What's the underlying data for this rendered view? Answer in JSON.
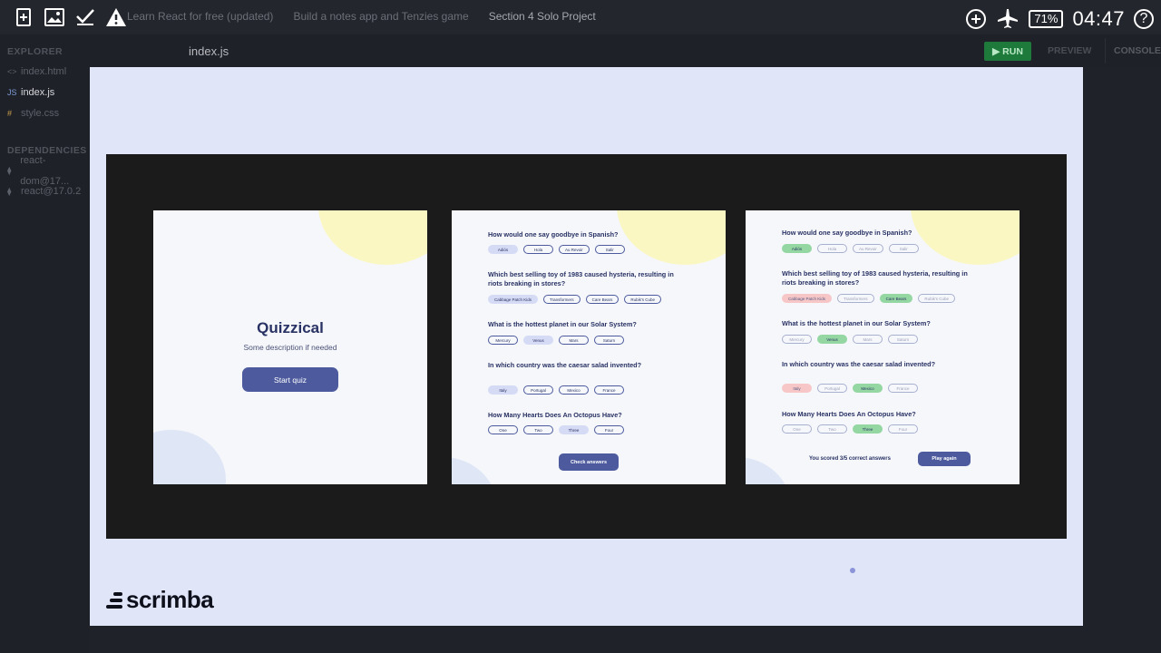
{
  "topbar": {
    "breadcrumbs": [
      "Learn React for free (updated)",
      "Build a notes app and Tenzies game",
      "Section 4 Solo Project"
    ],
    "battery": "71%",
    "clock": "04:47"
  },
  "sidebar": {
    "explorer_label": "EXPLORER",
    "files": [
      {
        "icon": "<>",
        "name": "index.html"
      },
      {
        "icon": "JS",
        "name": "index.js"
      },
      {
        "icon": "#",
        "name": "style.css"
      }
    ],
    "dependencies_label": "DEPENDENCIES",
    "dependencies": [
      "react-dom@17...",
      "react@17.0.2"
    ]
  },
  "editor": {
    "tab_name": "index.js",
    "run_label": "RUN",
    "preview_label": "PREVIEW",
    "console_label": "CONSOLE"
  },
  "slide": {
    "intro": {
      "title": "Quizzical",
      "description": "Some description if needed",
      "start_label": "Start quiz"
    },
    "questions": [
      {
        "q": "How would one say goodbye in Spanish?",
        "answers": [
          "Adiós",
          "Hola",
          "Au Revoir",
          "Salir"
        ]
      },
      {
        "q": "Which best selling toy of 1983 caused hysteria, resulting in riots breaking in stores?",
        "answers": [
          "Cabbage Patch Kids",
          "Transformers",
          "Care Bears",
          "Rubik's Cube"
        ]
      },
      {
        "q": "What is the hottest planet in our Solar System?",
        "answers": [
          "Mercury",
          "Venus",
          "Mars",
          "Saturn"
        ]
      },
      {
        "q": "In which country was the caesar salad invented?",
        "answers": [
          "Italy",
          "Portugal",
          "Mexico",
          "France"
        ]
      },
      {
        "q": "How Many Hearts Does An Octopus Have?",
        "answers": [
          "One",
          "Two",
          "Three",
          "Four"
        ]
      }
    ],
    "check_label": "Check answers",
    "score_text": "You scored 3/5 correct answers",
    "again_label": "Play again",
    "logo_text": "scrimba"
  }
}
